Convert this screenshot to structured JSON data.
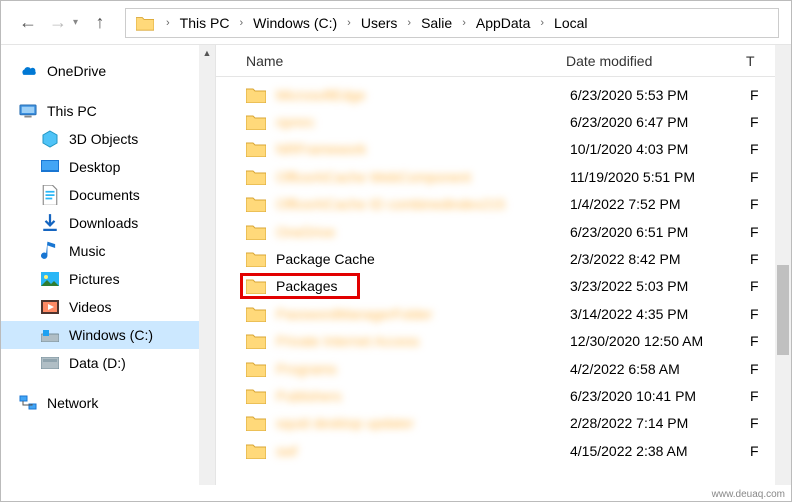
{
  "breadcrumb": {
    "segments": [
      "This PC",
      "Windows (C:)",
      "Users",
      "Salie",
      "AppData",
      "Local"
    ]
  },
  "sidebar": {
    "onedrive": "OneDrive",
    "thispc": "This PC",
    "items": [
      "3D Objects",
      "Desktop",
      "Documents",
      "Downloads",
      "Music",
      "Pictures",
      "Videos",
      "Windows (C:)",
      "Data (D:)"
    ],
    "network": "Network"
  },
  "columns": {
    "name": "Name",
    "date": "Date modified",
    "type": "T"
  },
  "files": [
    {
      "name": "MicrosoftEdge",
      "date": "6/23/2020 5:53 PM",
      "type": "F",
      "blurred": true
    },
    {
      "name": "npmrc",
      "date": "6/23/2020 6:47 PM",
      "type": "F",
      "blurred": true
    },
    {
      "name": "NRFramework",
      "date": "10/1/2020 4:03 PM",
      "type": "F",
      "blurred": true
    },
    {
      "name": "OfficeAICache WebComponent",
      "date": "11/19/2020 5:51 PM",
      "type": "F",
      "blurred": true
    },
    {
      "name": "OfficeAICache ID combinedindex215",
      "date": "1/4/2022 7:52 PM",
      "type": "F",
      "blurred": true
    },
    {
      "name": "OneDrive",
      "date": "6/23/2020 6:51 PM",
      "type": "F",
      "blurred": true
    },
    {
      "name": "Package Cache",
      "date": "2/3/2022 8:42 PM",
      "type": "F",
      "blurred": false
    },
    {
      "name": "Packages",
      "date": "3/23/2022 5:03 PM",
      "type": "F",
      "blurred": false,
      "highlighted": true
    },
    {
      "name": "PasswordManagerFolder",
      "date": "3/14/2022 4:35 PM",
      "type": "F",
      "blurred": true
    },
    {
      "name": "Private Internet Access",
      "date": "12/30/2020 12:50 AM",
      "type": "F",
      "blurred": true
    },
    {
      "name": "Programs",
      "date": "4/2/2022 6:58 AM",
      "type": "F",
      "blurred": true
    },
    {
      "name": "Publishers",
      "date": "6/23/2020 10:41 PM",
      "type": "F",
      "blurred": true
    },
    {
      "name": "squid desktop updater",
      "date": "2/28/2022 7:14 PM",
      "type": "F",
      "blurred": true
    },
    {
      "name": "swf",
      "date": "4/15/2022 2:38 AM",
      "type": "F",
      "blurred": true
    }
  ],
  "footer": "www.deuaq.com"
}
